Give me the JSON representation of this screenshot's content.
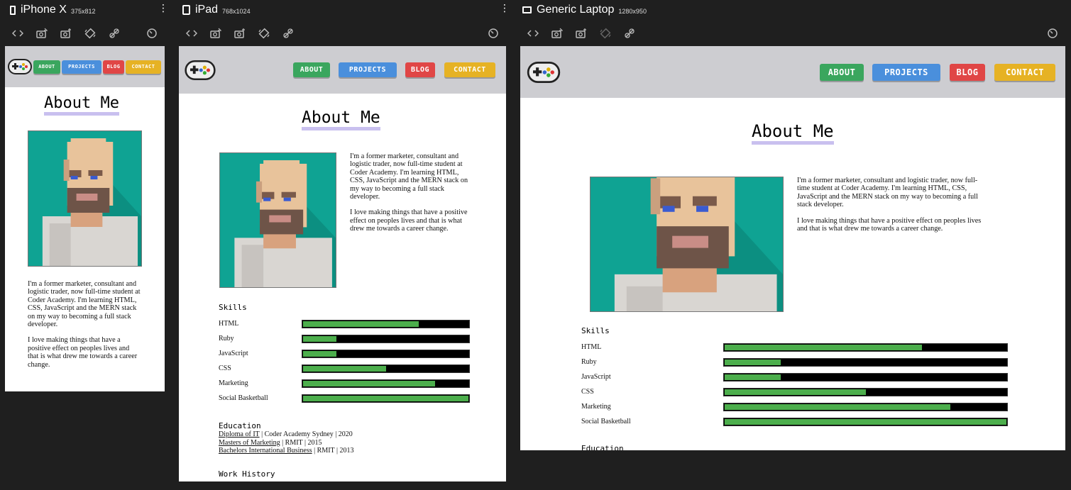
{
  "devices": [
    {
      "name": "iPhone X",
      "size": "375x812"
    },
    {
      "name": "iPad",
      "size": "768x1024"
    },
    {
      "name": "Generic Laptop",
      "size": "1280x950"
    }
  ],
  "icons": {
    "device_phone": "phone-icon",
    "device_tablet": "tablet-icon",
    "device_laptop": "laptop-icon",
    "tools": [
      "code-icon",
      "camera-edit-icon",
      "camera-add-icon",
      "rotate-icon",
      "link-icon"
    ],
    "reset": "reset-icon",
    "more": "more-icon",
    "logo": "gamepad-icon"
  },
  "nav": {
    "about": "ABOUT",
    "projects": "PROJECTS",
    "blog": "BLOG",
    "contact": "CONTACT"
  },
  "colors": {
    "about": "#3aa65e",
    "projects": "#4a8fdc",
    "blog": "#e04646",
    "contact": "#e6b224",
    "nav_bg": "#cdcdd1",
    "title_underline": "#c9c0ef",
    "skill_fill": "#4cae4c"
  },
  "page": {
    "title": "About Me",
    "bio1": "I'm a former marketer, consultant and logistic trader, now full-time student at Coder Academy. I'm learning HTML, CSS, JavaScript and the MERN stack on my way to becoming a full stack developer.",
    "bio2": "I love making things that have a positive effect on peoples lives and that is what drew me towards a career change.",
    "skills_title": "Skills",
    "skills": [
      {
        "name": "HTML",
        "level": 0.7
      },
      {
        "name": "Ruby",
        "level": 0.2
      },
      {
        "name": "JavaScript",
        "level": 0.2
      },
      {
        "name": "CSS",
        "level": 0.5
      },
      {
        "name": "Marketing",
        "level": 0.8
      },
      {
        "name": "Social Basketball",
        "level": 1.0
      }
    ],
    "education_title": "Education",
    "education": [
      {
        "degree": "Diploma of IT",
        "rest": "| Coder Academy Sydney | 2020"
      },
      {
        "degree": "Masters of Marketing",
        "rest": "| RMIT | 2015"
      },
      {
        "degree": "Bachelors International Business",
        "rest": "| RMIT | 2013"
      }
    ],
    "work_title": "Work History"
  }
}
